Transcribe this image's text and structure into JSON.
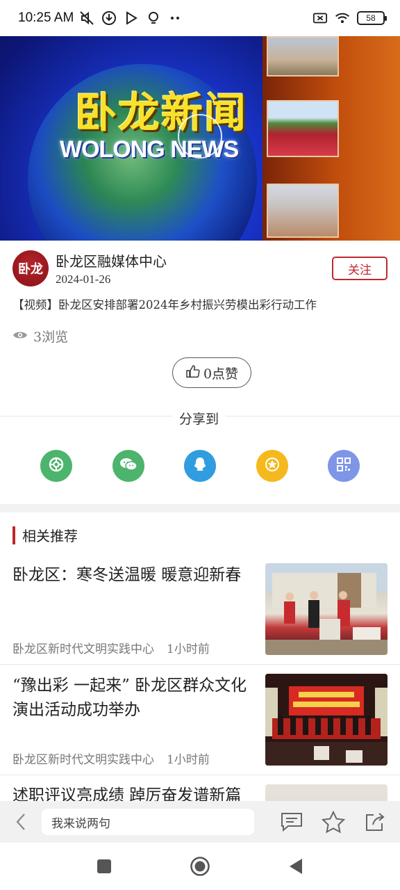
{
  "status_bar": {
    "time": "10:25 AM",
    "battery": "58",
    "icons_left": [
      "mute-icon",
      "download-icon",
      "play-store-icon",
      "bulb-icon",
      "more-dots-icon"
    ],
    "icons_right": [
      "close-box-icon",
      "wifi-icon",
      "battery-icon"
    ]
  },
  "banner": {
    "title_cn": "卧龙新闻",
    "title_en": "WOLONG NEWS"
  },
  "author": {
    "avatar_text": "卧龙",
    "name": "卧龙区融媒体中心",
    "date": "2024-01-26",
    "follow_label": "关注"
  },
  "article": {
    "title": "【视频】卧龙区安排部署2024年乡村振兴劳模出彩行动工作",
    "views": "3浏览",
    "like_label": "0点赞"
  },
  "share": {
    "label": "分享到",
    "targets": [
      {
        "icon": "moments-icon",
        "color": "#4cb46c"
      },
      {
        "icon": "wechat-icon",
        "color": "#4cb46c"
      },
      {
        "icon": "qq-icon",
        "color": "#2f9de0"
      },
      {
        "icon": "favorite-star-icon",
        "color": "#f5b91d"
      },
      {
        "icon": "qrcode-icon",
        "color": "#7f95e8"
      }
    ]
  },
  "related": {
    "heading": "相关推荐",
    "items": [
      {
        "title": "卧龙区：寒冬送温暖 暖意迎新春",
        "source": "卧龙区新时代文明实践中心",
        "time": "1小时前"
      },
      {
        "title": "“豫出彩 一起来” 卧龙区群众文化演出活动成功举办",
        "source": "卧龙区新时代文明实践中心",
        "time": "1小时前"
      },
      {
        "title": "述职评议亮成绩 踔厉奋发谱新篇",
        "source": "",
        "time": ""
      }
    ]
  },
  "comment_bar": {
    "placeholder": "我来说两句"
  }
}
